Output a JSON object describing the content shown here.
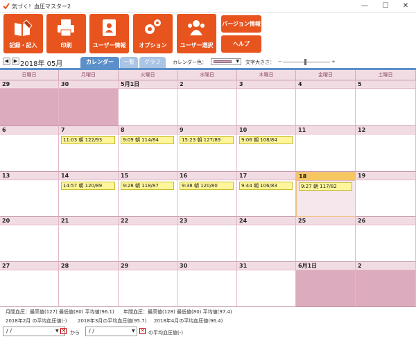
{
  "window": {
    "title": "気づく！血圧マスター2",
    "minimize": "—",
    "maximize": "☐",
    "close": "✕"
  },
  "toolbar": {
    "record": "記録・記入",
    "print": "印刷",
    "user_info": "ユーザー情報",
    "options": "オプション",
    "user_select": "ユーザー選択",
    "version": "バージョン情報",
    "help": "ヘルプ"
  },
  "nav": {
    "prev": "◀",
    "next": "▶",
    "month": "2018年 05月",
    "tabs": [
      "カレンダー",
      "一覧",
      "グラフ"
    ],
    "calendar_color_label": "カレンダー色：",
    "font_size_label": "文字大きさ：",
    "minus": "−",
    "plus": "+"
  },
  "weekdays": [
    "日曜日",
    "月曜日",
    "火曜日",
    "水曜日",
    "木曜日",
    "金曜日",
    "土曜日"
  ],
  "weeks": [
    [
      {
        "d": "29",
        "grey": true
      },
      {
        "d": "30",
        "grey": true
      },
      {
        "d": "5月1日"
      },
      {
        "d": "2"
      },
      {
        "d": "3"
      },
      {
        "d": "4"
      },
      {
        "d": "5"
      }
    ],
    [
      {
        "d": "6"
      },
      {
        "d": "7",
        "e": "11:03 朝 122/93"
      },
      {
        "d": "8",
        "e": "9:09 朝 114/84"
      },
      {
        "d": "9",
        "e": "15:23 朝 127/89"
      },
      {
        "d": "10",
        "e": "9:06 朝 108/84"
      },
      {
        "d": "11"
      },
      {
        "d": "12"
      }
    ],
    [
      {
        "d": "13"
      },
      {
        "d": "14",
        "e": "14:57 朝 120/89"
      },
      {
        "d": "15",
        "e": "9:28 朝 118/87"
      },
      {
        "d": "16",
        "e": "9:38 朝 120/80"
      },
      {
        "d": "17",
        "e": "9:44 朝 106/83"
      },
      {
        "d": "18",
        "e": "9:27 朝 117/82",
        "today": true
      },
      {
        "d": "19"
      }
    ],
    [
      {
        "d": "20"
      },
      {
        "d": "21"
      },
      {
        "d": "22"
      },
      {
        "d": "23"
      },
      {
        "d": "24"
      },
      {
        "d": "25"
      },
      {
        "d": "26"
      }
    ],
    [
      {
        "d": "27"
      },
      {
        "d": "28"
      },
      {
        "d": "29"
      },
      {
        "d": "30"
      },
      {
        "d": "31"
      },
      {
        "d": "6月1日",
        "grey": true
      },
      {
        "d": "2",
        "grey": true
      }
    ]
  ],
  "footer": {
    "monthly": "月間血圧：最高値(127) 最低値(80) 平均値(96.1)",
    "yearly": "年間血圧：最高値(128) 最低値(80) 平均値(97.4)",
    "avg_feb": "2018年2月 の平均血圧値(-)",
    "avg_mar": "2018年3月の平均血圧値(95.7)",
    "avg_apr": "2018年4月の平均血圧値(96.4)",
    "from_date": " /  / ",
    "from_label": "から",
    "to_date": " /  / ",
    "to_label": "の平均血圧値(-)",
    "clear": "✕"
  }
}
